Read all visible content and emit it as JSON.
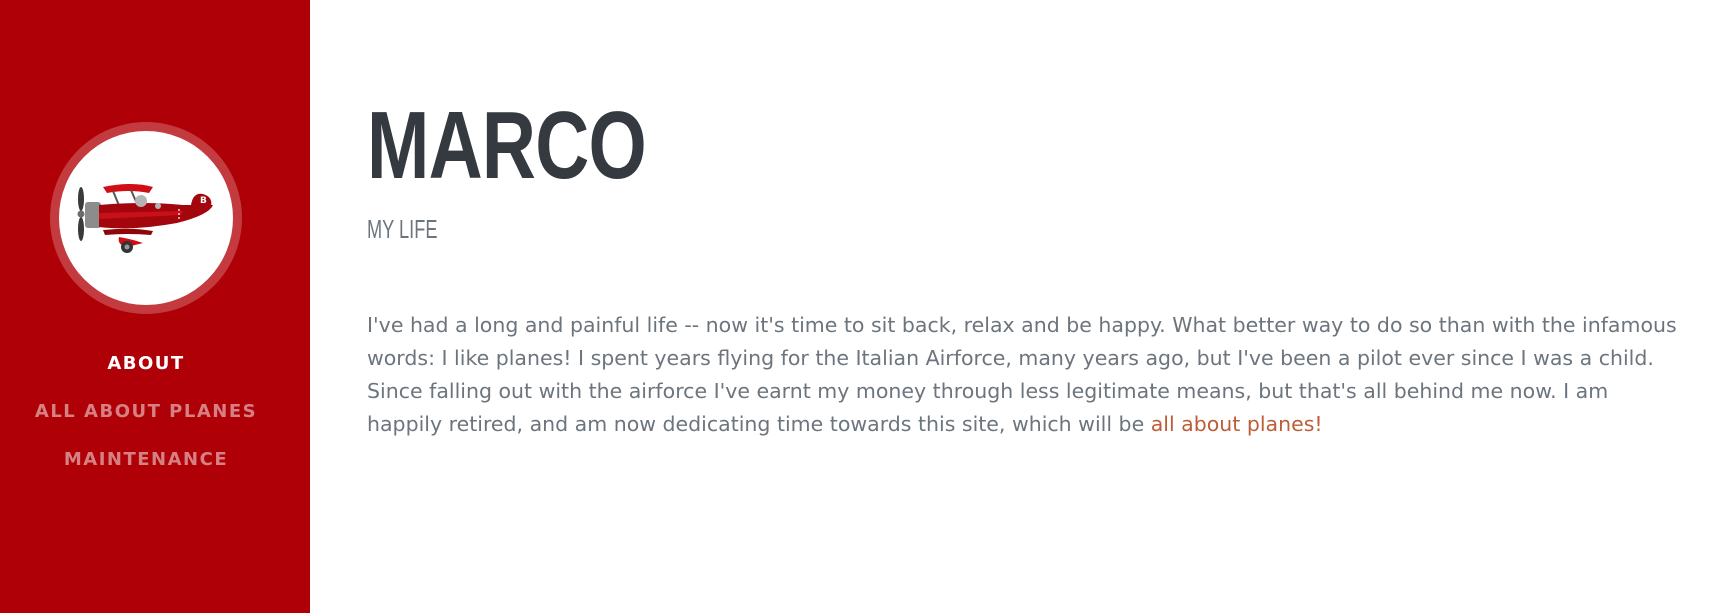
{
  "sidebar": {
    "avatar_icon": "biplane-icon",
    "plane_badge": "B",
    "nav": [
      {
        "label": "ABOUT",
        "active": true
      },
      {
        "label": "ALL ABOUT PLANES",
        "active": false
      },
      {
        "label": "MAINTENANCE",
        "active": false
      }
    ]
  },
  "main": {
    "name": "MARCO",
    "subtitle": "MY LIFE",
    "bio_text": "I've had a long and painful life -- now it's time to sit back, relax and be happy. What better way to do so than with the infamous words: I like planes! I spent years flying for the Italian Airforce, many years ago, but I've been a pilot ever since I was a child. Since falling out with the airforce I've earnt my money through less legitimate means, but that's all behind me now. I am happily retired, and am now dedicating time towards this site, which will be ",
    "bio_link": "all about planes!"
  },
  "colors": {
    "sidebar_bg": "#ae0006",
    "heading": "#343a40",
    "body_text": "#6c757d",
    "link": "#bd5d38"
  }
}
